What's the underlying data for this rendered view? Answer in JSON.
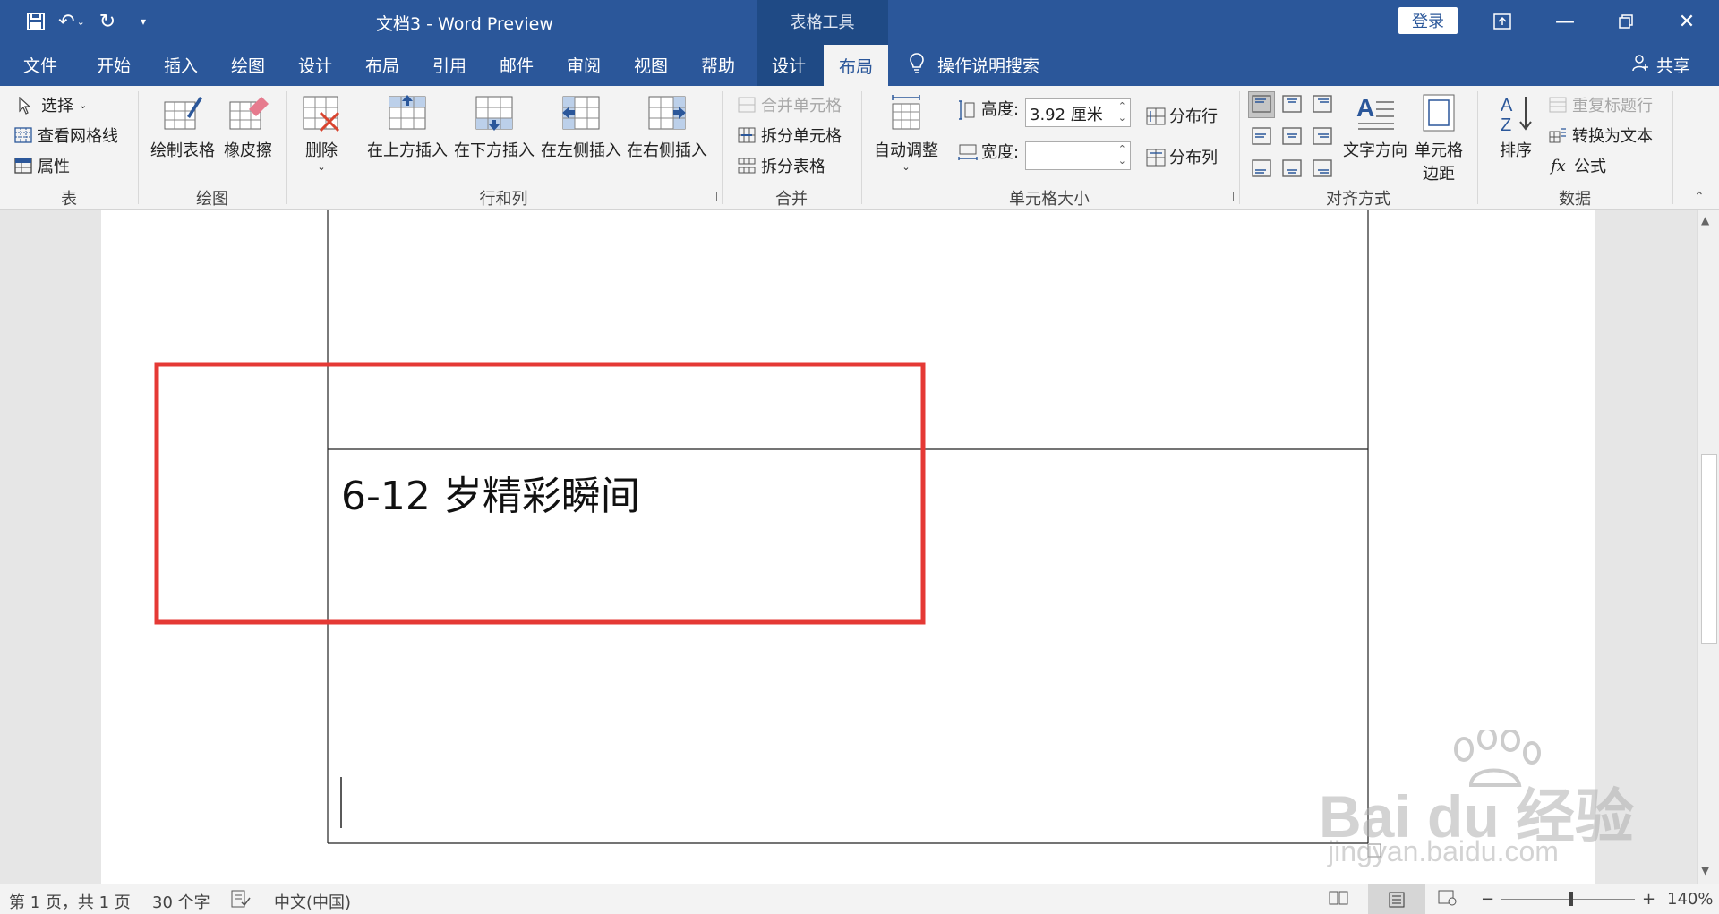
{
  "window": {
    "doc_title": "文档3  -  Word Preview",
    "context_tab_group": "表格工具",
    "login_label": "登录",
    "share_label": "共享"
  },
  "tabs": [
    {
      "label": "文件"
    },
    {
      "label": "开始"
    },
    {
      "label": "插入"
    },
    {
      "label": "绘图"
    },
    {
      "label": "设计"
    },
    {
      "label": "布局"
    },
    {
      "label": "引用"
    },
    {
      "label": "邮件"
    },
    {
      "label": "审阅"
    },
    {
      "label": "视图"
    },
    {
      "label": "帮助"
    },
    {
      "label": "设计"
    },
    {
      "label": "布局"
    }
  ],
  "search_label": "操作说明搜索",
  "ribbon": {
    "table": {
      "group": "表",
      "select": "选择",
      "view_gridlines": "查看网格线",
      "properties": "属性"
    },
    "draw": {
      "group": "绘图",
      "draw_table": "绘制表格",
      "eraser": "橡皮擦"
    },
    "rows_cols": {
      "group": "行和列",
      "delete": "删除",
      "insert_above": "在上方插入",
      "insert_below": "在下方插入",
      "insert_left": "在左侧插入",
      "insert_right": "在右侧插入"
    },
    "merge": {
      "group": "合并",
      "merge_cells": "合并单元格",
      "split_cells": "拆分单元格",
      "split_table": "拆分表格"
    },
    "cell_size": {
      "group": "单元格大小",
      "autofit": "自动调整",
      "height_label": "高度:",
      "height_value": "3.92 厘米",
      "width_label": "宽度:",
      "width_value": "",
      "distribute_rows": "分布行",
      "distribute_cols": "分布列"
    },
    "alignment": {
      "group": "对齐方式",
      "text_direction": "文字方向",
      "cell_margins_1": "单元格",
      "cell_margins_2": "边距"
    },
    "data": {
      "group": "数据",
      "sort": "排序",
      "repeat_header": "重复标题行",
      "convert_text": "转换为文本",
      "formula": "公式"
    }
  },
  "document": {
    "cell_text": "6-12 岁精彩瞬间",
    "watermark_main": "Bai du 经验",
    "watermark_sub": "jingyan.baidu.com"
  },
  "status": {
    "page": "第 1 页，共 1 页",
    "words": "30 个字",
    "language": "中文(中国)",
    "zoom": "140%"
  },
  "colors": {
    "brand": "#2b579a",
    "context": "#1f4a85",
    "highlight": "#e53935"
  }
}
